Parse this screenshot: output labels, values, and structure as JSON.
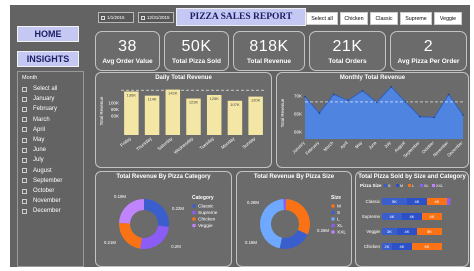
{
  "nav": {
    "home_label": "HOME",
    "insights_label": "INSIGHTS"
  },
  "month_slicer": {
    "header": "Month",
    "items": [
      "Select all",
      "January",
      "February",
      "March",
      "April",
      "May",
      "June",
      "July",
      "August",
      "September",
      "October",
      "November",
      "December"
    ]
  },
  "date_range": {
    "start": "1/1/2015",
    "end": "12/31/2015"
  },
  "report_title": "PIZZA SALES REPORT",
  "category_buttons": [
    "Select all",
    "Chicken",
    "Classic",
    "Supreme",
    "Veggie"
  ],
  "kpis": [
    {
      "value": "38",
      "label": "Avg Order Value"
    },
    {
      "value": "50K",
      "label": "Total Pizza Sold"
    },
    {
      "value": "818K",
      "label": "Total Revenue"
    },
    {
      "value": "21K",
      "label": "Total Orders"
    },
    {
      "value": "2",
      "label": "Avg Pizza Per Order"
    }
  ],
  "colors": {
    "background": "#636363",
    "panel": "#6b6b6b",
    "accent": "#c5c8f2",
    "bar_fill": "#f4e7a6",
    "line_area": "#4f86e8",
    "classic": "#3a5fcd",
    "supreme": "#8b5cf6",
    "chicken": "#f97316",
    "veggie": "#c084fc"
  },
  "charts": {
    "daily": {
      "title": "Daily Total Revenue",
      "ylabel": "Total Revenue",
      "ytick_labels": [
        "60K",
        "80K",
        "100K"
      ],
      "value_labels": [
        "107K",
        "114K",
        "120K",
        "123K",
        "125K",
        "136K",
        "142K"
      ]
    },
    "monthly": {
      "title": "Monthly Total Revenue",
      "ylabel": "Total Revenue",
      "ytick_labels": [
        "60K",
        "65K",
        "70K"
      ]
    },
    "category": {
      "title": "Total Revenue By Pizza Category",
      "legend_title": "Category",
      "value_labels": [
        "0.19M",
        "0.22M",
        "0.2M",
        "0.21M"
      ]
    },
    "size": {
      "title": "Total Revenue By Pizza Size",
      "legend_title": "Size",
      "value_labels": [
        "0.28M",
        "0.26M",
        "0.18M"
      ]
    },
    "size_category": {
      "title": "Total Pizza Sold by Size and Category",
      "legend_title": "Pizza Size"
    }
  },
  "chart_data": [
    {
      "type": "bar",
      "title": "Daily Total Revenue",
      "ylabel": "Total Revenue",
      "categories": [
        "Friday",
        "Thursday",
        "Saturday",
        "Wednesday",
        "Tuesday",
        "Monday",
        "Sunday"
      ],
      "values": [
        136000,
        123000,
        142000,
        114000,
        125000,
        107000,
        120000
      ],
      "ylim": [
        0,
        150000
      ]
    },
    {
      "type": "area",
      "title": "Monthly Total Revenue",
      "ylabel": "Total Revenue",
      "categories": [
        "January",
        "February",
        "March",
        "April",
        "May",
        "June",
        "July",
        "August",
        "September",
        "October",
        "November",
        "December"
      ],
      "values": [
        69800,
        65200,
        70400,
        68700,
        71400,
        68200,
        72500,
        68300,
        64200,
        64000,
        70400,
        64700
      ],
      "ylim": [
        58000,
        73000
      ]
    },
    {
      "type": "pie",
      "title": "Total Revenue By Pizza Category",
      "categories": [
        "Classic",
        "Supreme",
        "Chicken",
        "Veggie"
      ],
      "values": [
        0.22,
        0.21,
        0.19,
        0.2
      ]
    },
    {
      "type": "pie",
      "title": "Total Revenue By Pizza Size",
      "categories": [
        "M",
        "S",
        "L",
        "XL",
        "XXL"
      ],
      "values": [
        0.26,
        0.18,
        0.38,
        0.015,
        0.001
      ]
    },
    {
      "type": "bar",
      "title": "Total Pizza Sold by Size and Category",
      "categories": [
        "Classic",
        "Supreme",
        "Veggie",
        "Chicken"
      ],
      "series": [
        {
          "name": "S",
          "values": [
            5000,
            4000,
            3000,
            2000
          ]
        },
        {
          "name": "M",
          "values": [
            4000,
            4000,
            4000,
            4000
          ]
        },
        {
          "name": "L",
          "values": [
            4000,
            4000,
            5000,
            6000
          ]
        },
        {
          "name": "XL",
          "values": [
            600,
            0,
            0,
            0
          ]
        },
        {
          "name": "XXL",
          "values": [
            30,
            0,
            0,
            0
          ]
        }
      ],
      "segment_labels": [
        [
          "5K",
          "4K",
          "4K"
        ],
        [
          "4K",
          "4K",
          "4K"
        ],
        [
          "3K",
          "4K",
          "5K"
        ],
        [
          "2K",
          "4K",
          "6K"
        ]
      ]
    }
  ]
}
